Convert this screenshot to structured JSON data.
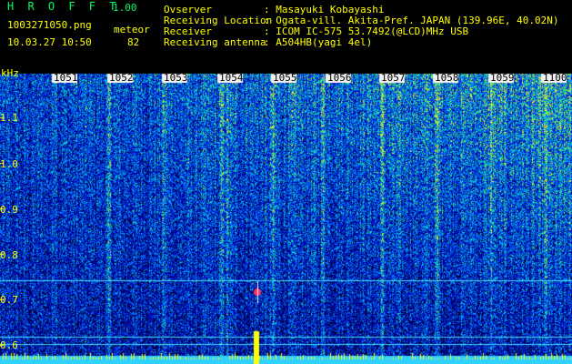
{
  "header": {
    "title": "H R O F F T",
    "version": "1.00",
    "filename": "1003271050.png",
    "event": "meteor",
    "datetime": "10.03.27 10:50",
    "count": "82"
  },
  "info": [
    {
      "label": "Ovserver",
      "value": ": Masayuki Kobayashi"
    },
    {
      "label": "Receiving Location",
      "value": ": Ogata-vill. Akita-Pref. JAPAN (139.96E, 40.02N)"
    },
    {
      "label": "Receiver",
      "value": ": ICOM IC-575 53.7492(@LCD)MHz USB"
    },
    {
      "label": "Receiving antenna",
      "value": ": A504HB(yagi 4el)"
    }
  ],
  "spectrogram": {
    "frequency_unit": "kHz",
    "y_ticks": [
      "1.1",
      "1.0",
      "0.9",
      "0.8",
      "0.7",
      "0.6"
    ],
    "x_ticks": [
      "1051",
      "1052",
      "1053",
      "1054",
      "1055",
      "1056",
      "1057",
      "1058",
      "1059",
      "1100"
    ],
    "colors": {
      "low": "#000080",
      "mid": "#0040ff",
      "high": "#00ff80",
      "peak": "#ffff00",
      "line": "#40e0ff"
    }
  }
}
